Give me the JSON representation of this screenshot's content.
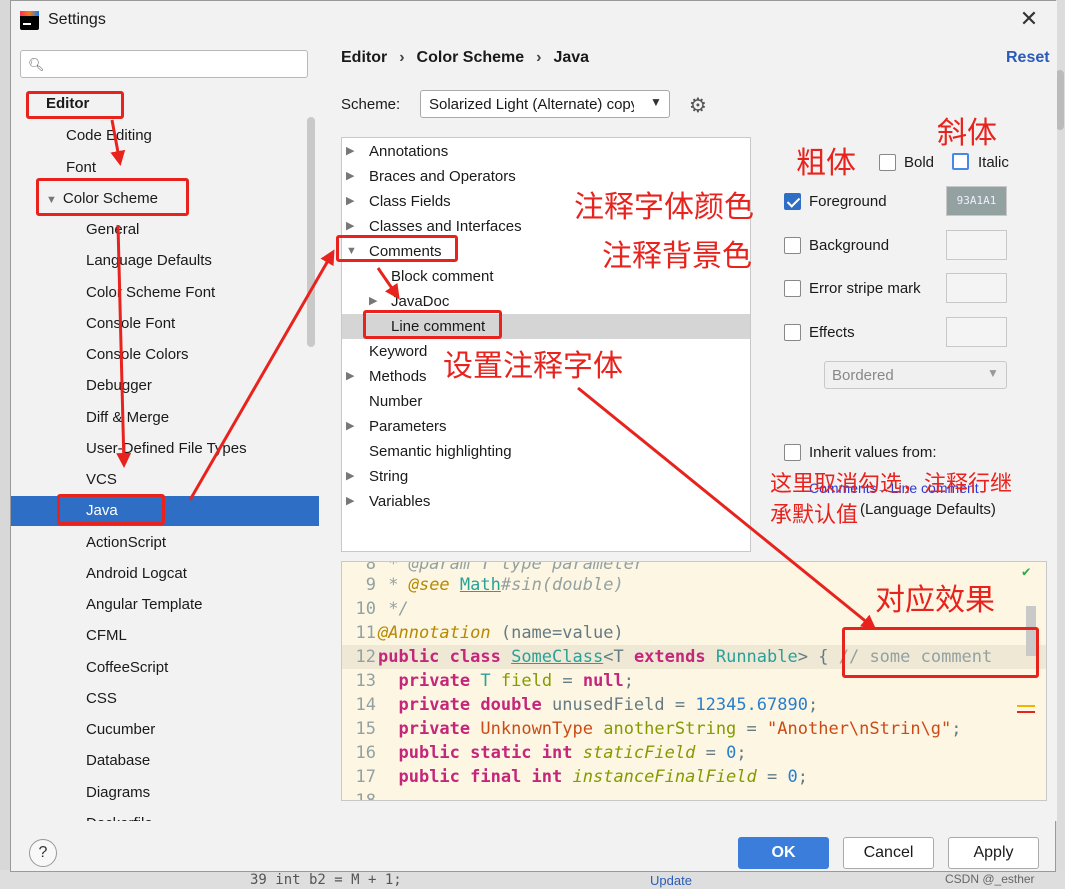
{
  "window": {
    "title": "Settings"
  },
  "search": {
    "placeholder": "",
    "value": ""
  },
  "sidebar": {
    "items": [
      {
        "label": "Editor"
      },
      {
        "label": "Code Editing"
      },
      {
        "label": "Font"
      },
      {
        "label": "Color Scheme"
      },
      {
        "label": "General"
      },
      {
        "label": "Language Defaults"
      },
      {
        "label": "Color Scheme Font"
      },
      {
        "label": "Console Font"
      },
      {
        "label": "Console Colors"
      },
      {
        "label": "Debugger"
      },
      {
        "label": "Diff & Merge"
      },
      {
        "label": "User-Defined File Types"
      },
      {
        "label": "VCS"
      },
      {
        "label": "Java"
      },
      {
        "label": "ActionScript"
      },
      {
        "label": "Android Logcat"
      },
      {
        "label": "Angular Template"
      },
      {
        "label": "CFML"
      },
      {
        "label": "CoffeeScript"
      },
      {
        "label": "CSS"
      },
      {
        "label": "Cucumber"
      },
      {
        "label": "Database"
      },
      {
        "label": "Diagrams"
      },
      {
        "label": "Dockerfile"
      }
    ]
  },
  "breadcrumb": {
    "part1": "Editor",
    "part2": "Color Scheme",
    "part3": "Java",
    "sep": "›"
  },
  "reset_label": "Reset",
  "scheme": {
    "label": "Scheme:",
    "value": "Solarized Light (Alternate) copy"
  },
  "tree": {
    "items": [
      {
        "label": "Annotations"
      },
      {
        "label": "Braces and Operators"
      },
      {
        "label": "Class Fields"
      },
      {
        "label": "Classes and Interfaces"
      },
      {
        "label": "Comments"
      },
      {
        "label": "Block comment"
      },
      {
        "label": "JavaDoc"
      },
      {
        "label": "Line comment"
      },
      {
        "label": "Keyword"
      },
      {
        "label": "Methods"
      },
      {
        "label": "Number"
      },
      {
        "label": "Parameters"
      },
      {
        "label": "Semantic highlighting"
      },
      {
        "label": "String"
      },
      {
        "label": "Variables"
      }
    ]
  },
  "attributes": {
    "bold": "Bold",
    "italic": "Italic",
    "foreground": "Foreground",
    "foreground_value": "93A1A1",
    "background": "Background",
    "error_stripe": "Error stripe mark",
    "effects": "Effects",
    "effects_type": "Bordered",
    "inherit": "Inherit values from:",
    "inherit_link": "Comments→Line comment",
    "inherit_sub": "(Language Defaults)"
  },
  "preview": {
    "lines": {
      "l8": "8",
      "l8_text": " * @param T type parameter",
      "l9": "9",
      "l10": "10",
      "l11": "11",
      "l12": "12",
      "l13": "13",
      "l14": "14",
      "l15": "15",
      "l16": "16",
      "l17": "17",
      "l18": "18"
    }
  },
  "buttons": {
    "help": "?",
    "ok": "OK",
    "cancel": "Cancel",
    "apply": "Apply"
  },
  "annotations": {
    "bold_note": "粗体",
    "italic_note": "斜体",
    "fg_note": "注释字体颜色",
    "bg_note": "注释背景色",
    "font_note": "设置注释字体",
    "inherit_note_1": "这里取消勾选，注释行继",
    "inherit_note_2": "承默认值",
    "effect_note": "对应效果"
  },
  "background": {
    "code": "39        int b2 = M + 1;",
    "update": "Update",
    "watermark": "CSDN @_esther"
  },
  "colors": {
    "accent": "#2e6fc5",
    "annotation_red": "#e8231e",
    "preview_bg": "#fdf6e3"
  }
}
